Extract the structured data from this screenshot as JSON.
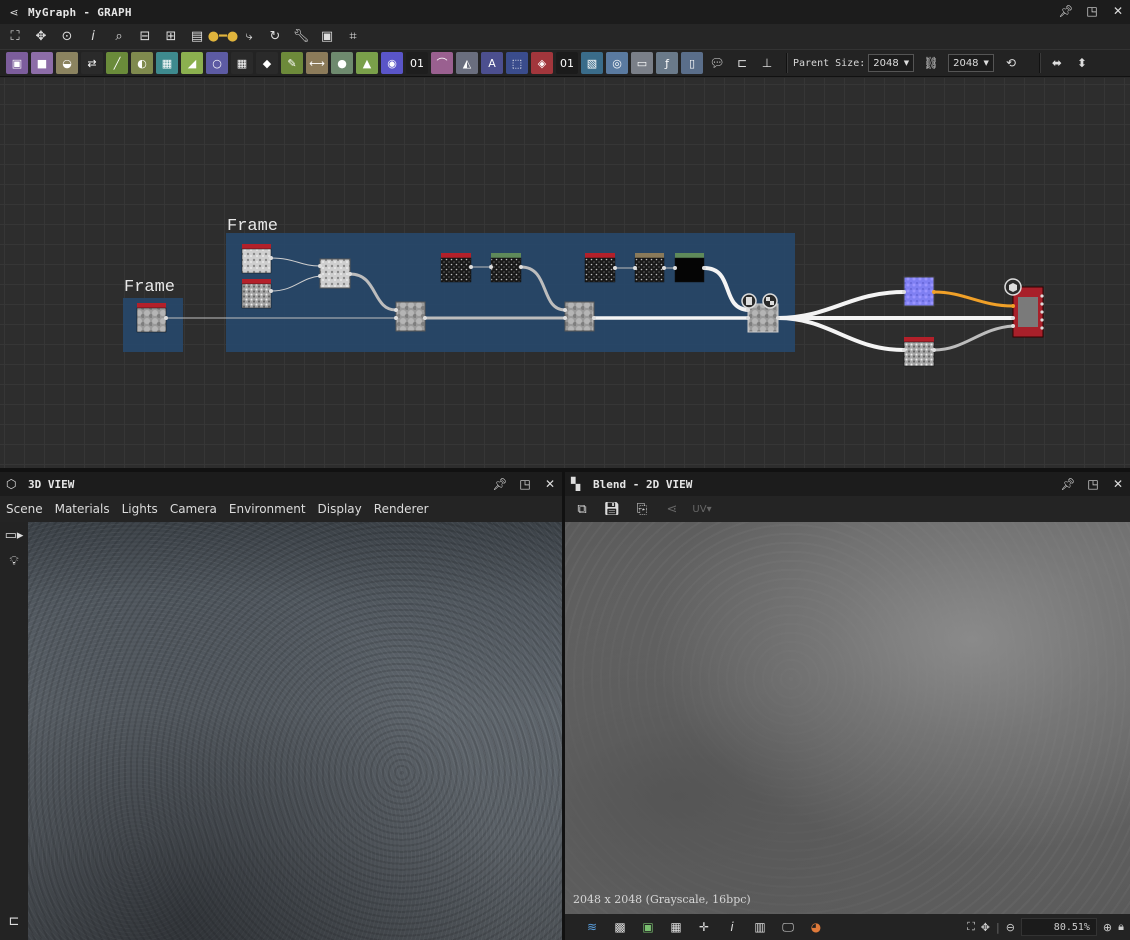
{
  "graph": {
    "title": "MyGraph - GRAPH",
    "parent_size_label": "Parent Size:",
    "parent_width": "2048",
    "parent_height": "2048",
    "frames": [
      {
        "label": "Frame"
      },
      {
        "label": "Frame"
      }
    ],
    "toolbar_icons": [
      "frame-all-icon",
      "center-icon",
      "snapshot-icon",
      "info-icon",
      "search-icon",
      "align-icon",
      "hierarchy-icon",
      "layers-icon",
      "connector-icon",
      "reroute-icon",
      "cycle-icon",
      "tools-icon",
      "preview-icon",
      "crop-icon"
    ],
    "atomic_nodes": [
      {
        "name": "bitmap",
        "color": "#7c5d9c",
        "glyph": "▣"
      },
      {
        "name": "uniform-color",
        "color": "#8d6da8",
        "glyph": "■"
      },
      {
        "name": "levels",
        "color": "#8b8360",
        "glyph": "◒"
      },
      {
        "name": "shuffle",
        "color": "#2a2a2a",
        "glyph": "⇄"
      },
      {
        "name": "curve",
        "color": "#6a8b3a",
        "glyph": "╱"
      },
      {
        "name": "blend",
        "color": "#7f8a4e",
        "glyph": "◐"
      },
      {
        "name": "warp",
        "color": "#3e8a8e",
        "glyph": "▦"
      },
      {
        "name": "gradient",
        "color": "#8bb04f",
        "glyph": "◢"
      },
      {
        "name": "transform",
        "color": "#5d5ba3",
        "glyph": "○"
      },
      {
        "name": "tile-sampler",
        "color": "#2a2a2a",
        "glyph": "▦"
      },
      {
        "name": "emboss",
        "color": "#2a2a2a",
        "glyph": "◆"
      },
      {
        "name": "paint",
        "color": "#6d8a3a",
        "glyph": "✎"
      },
      {
        "name": "gradient-map",
        "color": "#8c7b5a",
        "glyph": "⟷"
      },
      {
        "name": "sphere",
        "color": "#6e8a6e",
        "glyph": "●"
      },
      {
        "name": "histogram",
        "color": "#7aa04a",
        "glyph": "▲"
      },
      {
        "name": "hsl",
        "color": "#5a55c8",
        "glyph": "◉"
      },
      {
        "name": "noise",
        "color": "#1e1e1e",
        "glyph": "01"
      },
      {
        "name": "spline",
        "color": "#9a6090",
        "glyph": "⌒"
      },
      {
        "name": "mirror",
        "color": "#6a6e7e",
        "glyph": "◭"
      },
      {
        "name": "text",
        "color": "#4c4f8f",
        "glyph": "A"
      },
      {
        "name": "select",
        "color": "#3a4c8c",
        "glyph": "⬚"
      },
      {
        "name": "fill",
        "color": "#a2363c",
        "glyph": "◈"
      },
      {
        "name": "value",
        "color": "#1b1b1b",
        "glyph": "01"
      },
      {
        "name": "distance",
        "color": "#3a6c8a",
        "glyph": "▧"
      },
      {
        "name": "normal",
        "color": "#5a7aa0",
        "glyph": "◎"
      },
      {
        "name": "output",
        "color": "#7a7f88",
        "glyph": "▭"
      },
      {
        "name": "function",
        "color": "#6a7a8a",
        "glyph": "ƒ"
      },
      {
        "name": "input",
        "color": "#5a6e8a",
        "glyph": "▯"
      }
    ],
    "extra_tools": [
      "comment-icon",
      "pin-icon",
      "navigation-pin-icon"
    ],
    "link_icon": "link-icon",
    "reset_icon": "reset-icon",
    "right_tools": [
      "port-collapse-icon",
      "port-expand-icon"
    ]
  },
  "view3d": {
    "title": "3D VIEW",
    "menu": [
      "Scene",
      "Materials",
      "Lights",
      "Camera",
      "Environment",
      "Display",
      "Renderer"
    ]
  },
  "view2d": {
    "title": "Blend - 2D VIEW",
    "image_info": "2048 x 2048 (Grayscale, 16bpc)",
    "zoom": "80.51%"
  }
}
